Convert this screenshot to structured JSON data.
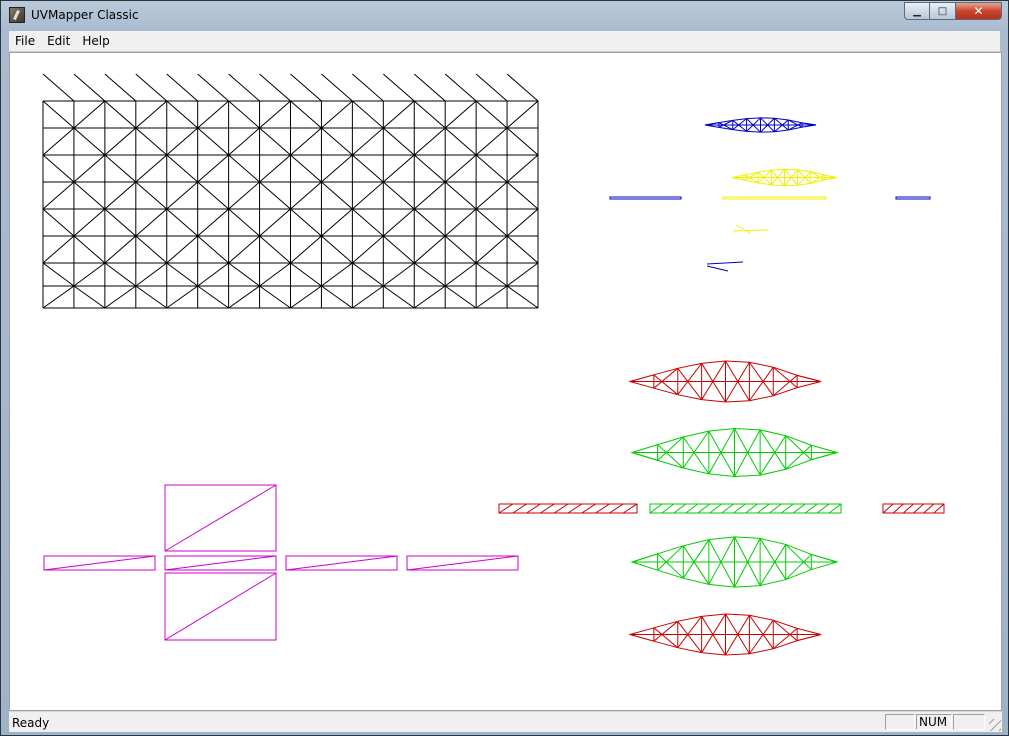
{
  "window": {
    "title": "UVMapper Classic",
    "minimize_glyph": "▁",
    "maximize_glyph": "□",
    "close_glyph": "✕"
  },
  "menu": [
    "File",
    "Edit",
    "Help"
  ],
  "status": {
    "text": "Ready",
    "panel_1": "",
    "panel_num": "NUM",
    "panel_3": ""
  },
  "colors": {
    "grid": "#000000",
    "blue": "#0000c0",
    "yellow": "#f0f000",
    "red": "#cc0000",
    "green": "#00cc00",
    "magenta": "#cc00cc"
  }
}
